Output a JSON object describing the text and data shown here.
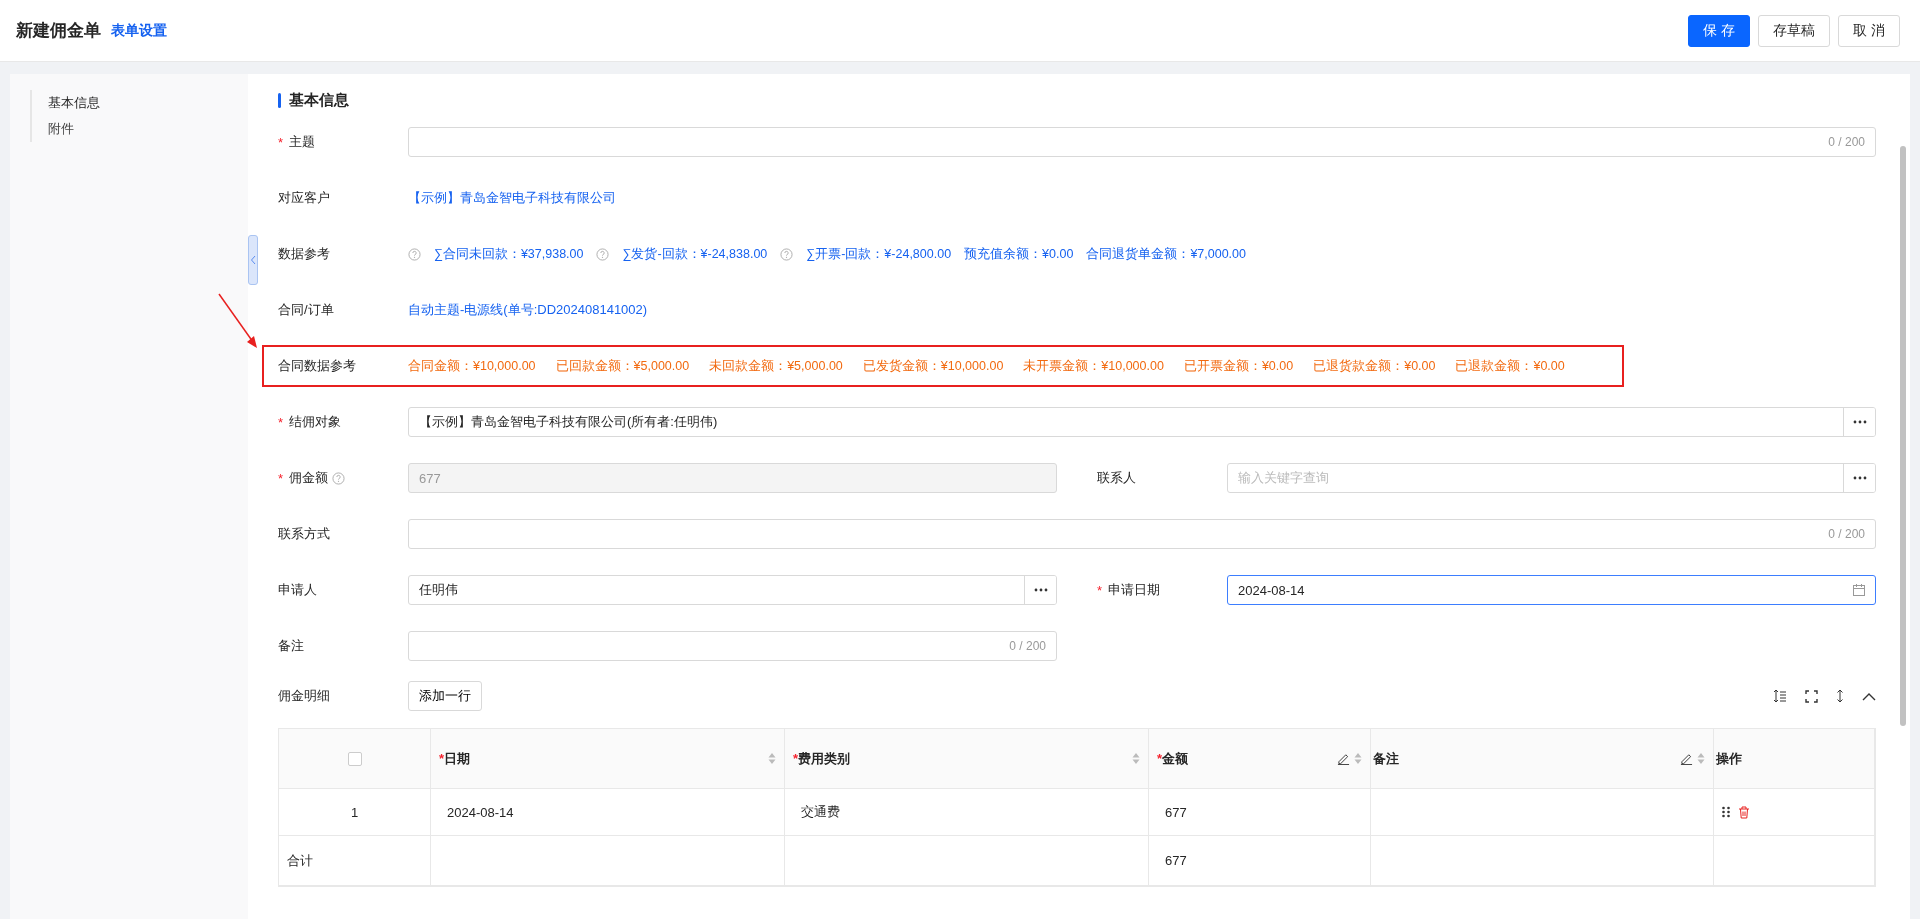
{
  "header": {
    "title": "新建佣金单",
    "settings_link": "表单设置",
    "buttons": [
      {
        "label": "保 存",
        "kind": "primary"
      },
      {
        "label": "存草稿",
        "kind": "default"
      },
      {
        "label": "取 消",
        "kind": "default"
      }
    ]
  },
  "sidebar": {
    "items": [
      {
        "label": "基本信息",
        "selected": true
      },
      {
        "label": "附件",
        "selected": false
      }
    ]
  },
  "section_title": "基本信息",
  "rows": [
    {
      "kind": "text-input",
      "label": "主题",
      "mark": "*",
      "counter": "0 / 200"
    },
    {
      "kind": "link",
      "label": "对应客户",
      "text": "【示例】青岛金智电子科技有限公司"
    },
    {
      "kind": "references",
      "label": "数据参考",
      "items": [
        {
          "text": "∑合同未回款：¥37,938.00",
          "help": true
        },
        {
          "text": "∑发货-回款：¥-24,838.00",
          "help": true
        },
        {
          "text": "∑开票-回款：¥-24,800.00",
          "help": true
        },
        {
          "text": "预充值余额：¥0.00"
        },
        {
          "text": "合同退货单金额：¥7,000.00"
        }
      ]
    },
    {
      "kind": "link",
      "label": "合同/订单",
      "text": "自动主题-电源线(单号:DD202408141002)"
    },
    {
      "kind": "contract-data",
      "label": "合同数据参考",
      "highlighted": true,
      "items": [
        "合同金额：¥10,000.00",
        "已回款金额：¥5,000.00",
        "未回款金额：¥5,000.00",
        "已发货金额：¥10,000.00",
        "未开票金额：¥10,000.00",
        "已开票金额：¥0.00",
        "已退货款金额：¥0.00",
        "已退款金额：¥0.00"
      ]
    },
    {
      "kind": "picker",
      "label": "结佣对象",
      "mark": "*",
      "value": "【示例】青岛金智电子科技有限公司(所有者:任明伟)"
    },
    {
      "kind": "pair",
      "fields": [
        {
          "kind": "disabled",
          "label": "佣金额",
          "mark": "*",
          "help": true,
          "value": "677"
        },
        {
          "kind": "picker",
          "label": "联系人",
          "placeholder": "输入关键字查询"
        }
      ]
    },
    {
      "kind": "text-input",
      "label": "联系方式",
      "counter": "0 / 200"
    },
    {
      "kind": "pair",
      "fields": [
        {
          "kind": "picker",
          "label": "申请人",
          "value": "任明伟"
        },
        {
          "kind": "date",
          "label": "申请日期",
          "mark": "*",
          "value": "2024-08-14",
          "focused": true
        }
      ]
    },
    {
      "kind": "pair",
      "fields": [
        {
          "kind": "text-input",
          "label": "备注",
          "counter": "0 / 200"
        }
      ]
    }
  ],
  "detail": {
    "label": "佣金明细",
    "add_button": "添加一行",
    "all_checked": false,
    "columns": [
      {
        "label": "日期",
        "mark": "*",
        "sortable": true
      },
      {
        "label": "费用类别",
        "mark": "*",
        "sortable": true
      },
      {
        "label": "金额",
        "mark": "*",
        "editable": true,
        "sortable": true
      },
      {
        "label": "备注",
        "editable": true,
        "sortable": true
      },
      {
        "label": "操作"
      }
    ],
    "rows": [
      {
        "index": "1",
        "cells": [
          "2024-08-14",
          "交通费",
          "677",
          null
        ]
      }
    ],
    "total": {
      "label": "合计",
      "cells": [
        null,
        null,
        "677",
        null
      ]
    }
  }
}
